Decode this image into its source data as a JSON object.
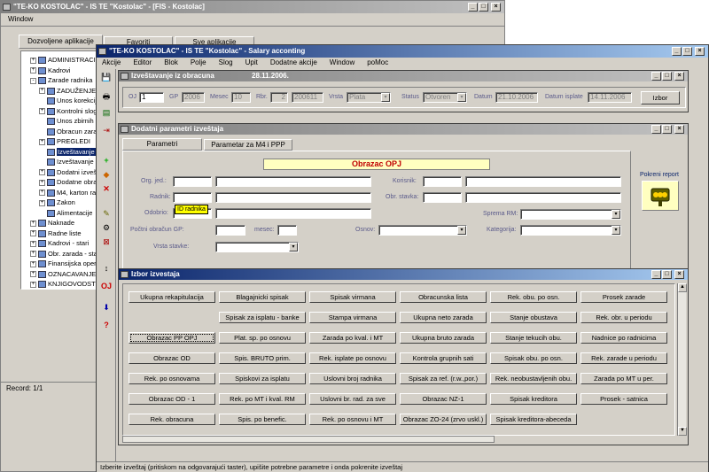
{
  "back_window": {
    "title": "\"TE-KO KOSTOLAC\" - IS TE \"Kostolac\" - [FIS - Kostolac]",
    "menu": "Window",
    "tabs": [
      "Dozvoljene aplikacije",
      "Favoriti",
      "Sve aplikacije"
    ],
    "tree": [
      {
        "label": "ADMINISTRACIJA",
        "level": 0,
        "exp": "+"
      },
      {
        "label": "Kadrovi",
        "level": 0,
        "exp": "+"
      },
      {
        "label": "Zarade radnika",
        "level": 0,
        "exp": "-"
      },
      {
        "label": "ZADUŽENJE",
        "level": 1,
        "exp": "+"
      },
      {
        "label": "Unos korekcija",
        "level": 1,
        "exp": ""
      },
      {
        "label": "Kontrolni slogovi",
        "level": 1,
        "exp": "+"
      },
      {
        "label": "Unos zbirnih",
        "level": 1,
        "exp": ""
      },
      {
        "label": "Obracun zarada",
        "level": 1,
        "exp": ""
      },
      {
        "label": "PREGLEDI",
        "level": 1,
        "exp": "+"
      },
      {
        "label": "Izveštavanje",
        "level": 1,
        "exp": "",
        "selected": true
      },
      {
        "label": "Izveštavanje iz obracuna",
        "level": 1,
        "exp": ""
      },
      {
        "label": "Dodatni izveštaji",
        "level": 1,
        "exp": "+"
      },
      {
        "label": "Dodatne obrade",
        "level": 1,
        "exp": "+"
      },
      {
        "label": "M4, karton radnika",
        "level": 1,
        "exp": "+"
      },
      {
        "label": "Zakon",
        "level": 1,
        "exp": "+"
      },
      {
        "label": "Alimentacije",
        "level": 1,
        "exp": ""
      },
      {
        "label": "Naknade",
        "level": 0,
        "exp": "+"
      },
      {
        "label": "Radne liste",
        "level": 0,
        "exp": "+"
      },
      {
        "label": "Kadrovi - stari",
        "level": 0,
        "exp": "+"
      },
      {
        "label": "Obr. zarada - stari",
        "level": 0,
        "exp": "+"
      },
      {
        "label": "Finansijska operativa",
        "level": 0,
        "exp": "+"
      },
      {
        "label": "OZNACAVANJE",
        "level": 0,
        "exp": "+"
      },
      {
        "label": "KNJIGOVODSTVO",
        "level": 0,
        "exp": "+"
      }
    ],
    "status": "Record: 1/1"
  },
  "front_window": {
    "title": "\"TE-KO KOSTOLAC\" - IS TE \"Kostolac\" - Salary acconting",
    "menu": [
      "Akcije",
      "Editor",
      "Blok",
      "Polje",
      "Slog",
      "Upit",
      "Dodatne akcije",
      "Window",
      "poMoc"
    ]
  },
  "panel1": {
    "title": "Izveštavanje iz obracuna",
    "date": "28.11.2006.",
    "fields": [
      {
        "label": "OJ",
        "value": "1"
      },
      {
        "label": "GP",
        "value": "2006"
      },
      {
        "label": "Mesec",
        "value": "10"
      },
      {
        "label": "Rbr.",
        "value": "2"
      },
      {
        "label": "",
        "value": "200611"
      },
      {
        "label": "Vrsta",
        "value": "Plata"
      },
      {
        "label": "Status",
        "value": "Otvoren"
      },
      {
        "label": "Datum",
        "value": "21.10.2006"
      },
      {
        "label": "Datum isplate",
        "value": "14.11.2006"
      }
    ],
    "button": "Izbor"
  },
  "panel2": {
    "title": "Dodatni parametri izveštaja",
    "tabs": [
      "Parametri",
      "Parametar za M4 i PPP"
    ],
    "header": "Obrazac OPJ",
    "labels": {
      "org": "Org. jed.:",
      "radnik": "Radnik:",
      "odobrio": "Odobrio:",
      "period": "Počtni obračun GP:",
      "mesec": "mesec:",
      "vrsta": "Vrsta stavke:",
      "korisnik": "Korisnik:",
      "obr": "Obr. stavka:",
      "sprema": "Sprema RM:",
      "osnov": "Osnov:",
      "kategorija": "Kategorija:"
    },
    "tooltip": "ID radnika",
    "report_label": "Pokreni report"
  },
  "panel3": {
    "title": "Izbor izvestaja",
    "buttons": [
      [
        "Ukupna rekapitulacija",
        "Blagajnicki spisak",
        "Spisak virmana",
        "Obracunska lista",
        "Rek. obu. po osn.",
        "Prosek zarade"
      ],
      [
        "",
        "Spisak za isplatu - banke",
        "Stampa virmana",
        "Ukupna neto zarada",
        "Stanje obustava",
        "Rek. obr. u periodu"
      ],
      [
        "Obrazac PP OPJ",
        "Plat. sp. po osnovu",
        "Zarada po kval. i MT",
        "Ukupna bruto zarada",
        "Stanje tekucih obu.",
        "Nadnice po radnicima"
      ],
      [
        "Obrazac OD",
        "Spis. BRUTO prim.",
        "Rek. isplate po osnovu",
        "Kontrola grupnih sati",
        "Spisak obu. po osn.",
        "Rek. zarade u periodu"
      ],
      [
        "Rek. po osnovama",
        "Spiskovi za isplatu",
        "Uslovni broj radnika",
        "Spisak za ref. (r.w.,por.)",
        "Rek. neobustavljenih obu.",
        "Zarada po MT u per."
      ],
      [
        "Obrazac OD - 1",
        "Rek. po MT i kval. RM",
        "Uslovni br. rad. za sve",
        "Obrazac NZ-1",
        "Spisak kreditora",
        "Prosek - satnica"
      ],
      [
        "Rek. obracuna",
        "Spis. po benefic.",
        "Rek. po osnovu i MT",
        "Obrazac ZO-24 (zrvo uskl.)",
        "Spisak kreditora-abeceda",
        ""
      ]
    ]
  },
  "statusbar": "Izberite izveštaj (pritiskom na odgovarajući taster), upišite potrebne parametre i onda pokrenite izveštaj",
  "toolbar": [
    "save-icon",
    "print-icon",
    "exit-icon",
    "insert-icon",
    "delete-icon",
    "query-icon",
    "sort-icon",
    "help-icon"
  ]
}
